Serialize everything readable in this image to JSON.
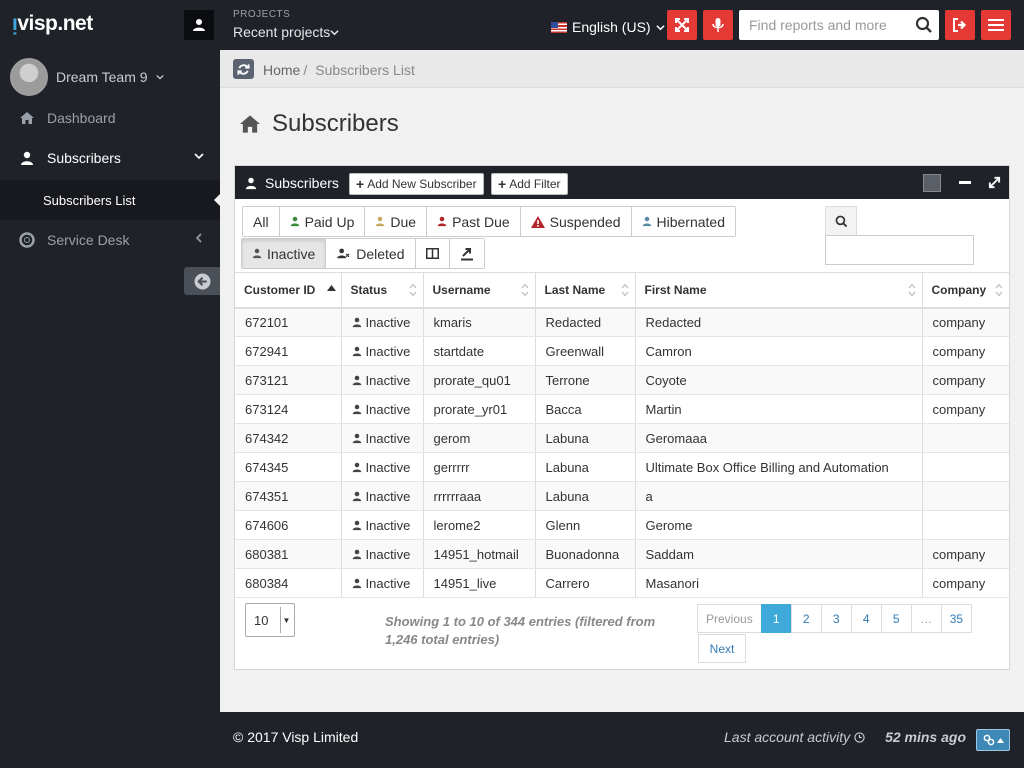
{
  "topbar": {
    "logo": "visp.net",
    "projects_label": "PROJECTS",
    "projects_value": "Recent projects",
    "language": "English (US)",
    "search_placeholder": "Find reports and more"
  },
  "sidebar": {
    "team_name": "Dream Team 9",
    "items": [
      {
        "label": "Dashboard",
        "icon": "home-icon"
      },
      {
        "label": "Subscribers",
        "icon": "user-icon"
      },
      {
        "label": "Subscribers List"
      },
      {
        "label": "Service Desk",
        "icon": "life-ring-icon"
      }
    ]
  },
  "breadcrumb": {
    "home": "Home",
    "separator": "/",
    "current": "Subscribers List"
  },
  "page_title": "Subscribers",
  "panel": {
    "title": "Subscribers",
    "add_subscriber": "Add New Subscriber",
    "add_filter": "Add Filter"
  },
  "filters": [
    {
      "label": "All",
      "color": ""
    },
    {
      "label": "Paid Up",
      "color": "#3a8a3a"
    },
    {
      "label": "Due",
      "color": "#c6a85c"
    },
    {
      "label": "Past Due",
      "color": "#b2252b"
    },
    {
      "label": "Suspended",
      "color": "#b2252b"
    },
    {
      "label": "Hibernated",
      "color": "#5a8aa8"
    },
    {
      "label": "Inactive",
      "color": "#555555"
    },
    {
      "label": "Deleted",
      "color": "#333333"
    }
  ],
  "table": {
    "columns": [
      "Customer ID",
      "Status",
      "Username",
      "Last Name",
      "First Name",
      "Company"
    ],
    "rows": [
      {
        "id": "672101",
        "status": "Inactive",
        "username": "kmaris",
        "last": "Redacted",
        "first": "Redacted",
        "company": "company"
      },
      {
        "id": "672941",
        "status": "Inactive",
        "username": "startdate",
        "last": "Greenwall",
        "first": "Camron",
        "company": "company"
      },
      {
        "id": "673121",
        "status": "Inactive",
        "username": "prorate_qu01",
        "last": "Terrone",
        "first": "Coyote",
        "company": "company"
      },
      {
        "id": "673124",
        "status": "Inactive",
        "username": "prorate_yr01",
        "last": "Bacca",
        "first": "Martin",
        "company": "company"
      },
      {
        "id": "674342",
        "status": "Inactive",
        "username": "gerom",
        "last": "Labuna",
        "first": "Geromaaa",
        "company": ""
      },
      {
        "id": "674345",
        "status": "Inactive",
        "username": "gerrrrr",
        "last": "Labuna",
        "first": "Ultimate Box Office Billing and Automation",
        "company": ""
      },
      {
        "id": "674351",
        "status": "Inactive",
        "username": "rrrrrraaa",
        "last": "Labuna",
        "first": "a",
        "company": ""
      },
      {
        "id": "674606",
        "status": "Inactive",
        "username": "lerome2",
        "last": "Glenn",
        "first": "Gerome",
        "company": ""
      },
      {
        "id": "680381",
        "status": "Inactive",
        "username": "14951_hotmail",
        "last": "Buonadonna",
        "first": "Saddam",
        "company": "company"
      },
      {
        "id": "680384",
        "status": "Inactive",
        "username": "14951_live",
        "last": "Carrero",
        "first": "Masanori",
        "company": "company"
      }
    ]
  },
  "page_length": "10",
  "info_text": "Showing 1 to 10 of 344 entries (filtered from 1,246 total entries)",
  "pagination": {
    "previous": "Previous",
    "pages": [
      "1",
      "2",
      "3",
      "4",
      "5",
      "…",
      "35"
    ],
    "current": "1",
    "next": "Next"
  },
  "footer": {
    "copyright": "© 2017 Visp Limited",
    "activity_label": "Last account activity",
    "activity_value": "52 mins ago"
  },
  "colors": {
    "accent_red": "#e53935",
    "dark_bg": "#1f2229",
    "pager_active": "#3fa9d9"
  }
}
